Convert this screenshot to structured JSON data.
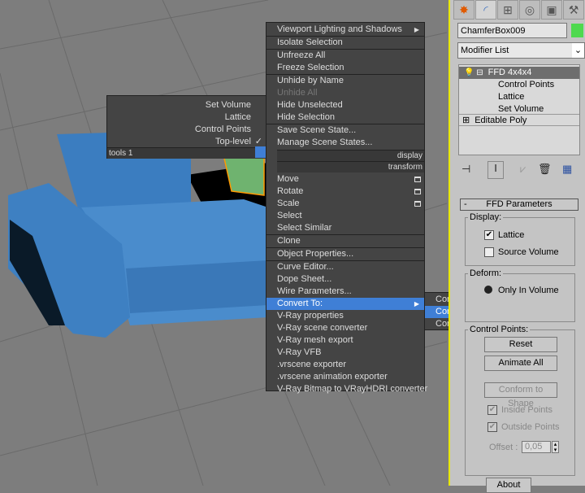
{
  "quad_left": {
    "items": [
      {
        "label": "Set Volume"
      },
      {
        "label": "Lattice"
      },
      {
        "label": "Control Points"
      },
      {
        "label": "Top-level",
        "checked": true
      }
    ],
    "footer": "tools 1"
  },
  "quad_right": {
    "display_header": "display",
    "transform_header": "transform",
    "items": [
      {
        "label": "Viewport Lighting and Shadows",
        "submenu": true
      },
      {
        "label": "Isolate Selection",
        "sep": true
      },
      {
        "label": "Unfreeze All",
        "sep": true
      },
      {
        "label": "Freeze Selection"
      },
      {
        "label": "Unhide by Name",
        "sep": true
      },
      {
        "label": "Unhide All",
        "disabled": true
      },
      {
        "label": "Hide Unselected"
      },
      {
        "label": "Hide Selection"
      },
      {
        "label": "Save Scene State...",
        "sep": true
      },
      {
        "label": "Manage Scene States..."
      }
    ],
    "transform_items": [
      {
        "label": "Move",
        "box": true
      },
      {
        "label": "Rotate",
        "box": true
      },
      {
        "label": "Scale",
        "box": true
      },
      {
        "label": "Select"
      },
      {
        "label": "Select Similar"
      },
      {
        "label": "Clone",
        "sep": true
      },
      {
        "label": "Object Properties...",
        "sep": true
      },
      {
        "label": "Curve Editor...",
        "sep": true
      },
      {
        "label": "Dope Sheet..."
      },
      {
        "label": "Wire Parameters..."
      },
      {
        "label": "Convert To:",
        "submenu": true,
        "highlighted": true
      },
      {
        "label": "V-Ray properties"
      },
      {
        "label": "V-Ray scene converter"
      },
      {
        "label": "V-Ray mesh export"
      },
      {
        "label": "V-Ray VFB"
      },
      {
        "label": ".vrscene exporter"
      },
      {
        "label": ".vrscene animation exporter"
      },
      {
        "label": "V-Ray Bitmap to VRayHDRI converter"
      }
    ]
  },
  "convert_submenu": [
    {
      "label": "Convert to Editable Mesh"
    },
    {
      "label": "Convert to Editable Poly",
      "highlighted": true
    },
    {
      "label": "Convert to Editable Patch"
    }
  ],
  "panel": {
    "tabs": [
      "create-icon",
      "modify-icon",
      "hierarchy-icon",
      "motion-icon",
      "display-icon",
      "utilities-icon"
    ],
    "object_name": "ChamferBox009",
    "object_color": "#4fd94f",
    "modifier_list": "Modifier List",
    "stack": [
      {
        "label": "FFD 4x4x4",
        "selected": true
      },
      {
        "label": "Control Points",
        "sub": true
      },
      {
        "label": "Lattice",
        "sub": true
      },
      {
        "label": "Set Volume",
        "sub": true
      },
      {
        "label": "Editable Poly"
      }
    ],
    "rollout_title": "FFD Parameters",
    "collapse": "-",
    "display_group": "Display:",
    "lattice": "Lattice",
    "lattice_checked": true,
    "source_volume": "Source Volume",
    "source_volume_checked": false,
    "deform_group": "Deform:",
    "only_in_volume": "Only In Volume",
    "control_points_group": "Control Points:",
    "reset": "Reset",
    "animate_all": "Animate All",
    "conform": "Conform to Shape",
    "inside_points": "Inside Points",
    "outside_points": "Outside Points",
    "offset_label": "Offset :",
    "offset_value": "0,05",
    "about": "About"
  },
  "colors": {
    "accent": "#3f7fd6",
    "menu_bg": "#444444",
    "sofa": "#3d7fc0"
  }
}
